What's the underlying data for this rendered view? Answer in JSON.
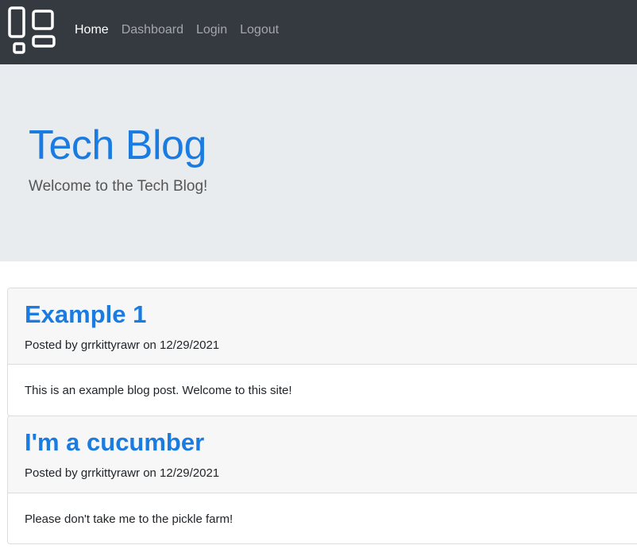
{
  "nav": {
    "logo_icon": "dashboard-layout-icon",
    "links": [
      {
        "label": "Home",
        "active": true
      },
      {
        "label": "Dashboard",
        "active": false
      },
      {
        "label": "Login",
        "active": false
      },
      {
        "label": "Logout",
        "active": false
      }
    ]
  },
  "hero": {
    "title": "Tech Blog",
    "subtitle": "Welcome to the Tech Blog!"
  },
  "posts": [
    {
      "title": "Example 1",
      "meta": "Posted by grrkittyrawr on 12/29/2021",
      "body": "This is an example blog post. Welcome to this site!"
    },
    {
      "title": "I'm a cucumber",
      "meta": "Posted by grrkittyrawr on 12/29/2021",
      "body": "Please don't take me to the pickle farm!"
    }
  ],
  "colors": {
    "navbar_bg": "#343a40",
    "jumbotron_bg": "#e9ecef",
    "primary": "#1a7be0"
  }
}
